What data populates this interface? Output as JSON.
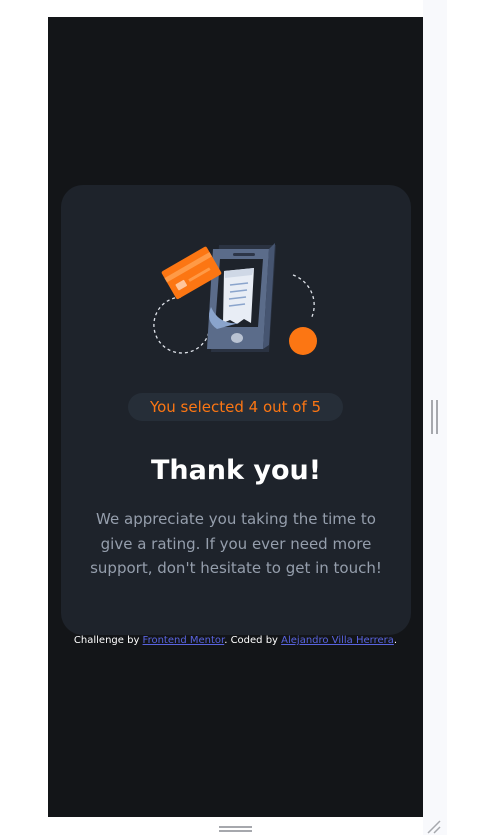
{
  "card": {
    "selection_text": "You selected 4 out of 5",
    "title": "Thank you!",
    "description": "We appreciate you taking the time to give a rating. If you ever need more support, don't hesitate to get in touch!"
  },
  "attribution": {
    "prefix": "Challenge by ",
    "link1": "Frontend Mentor",
    "middle": ". Coded by ",
    "link2": "Alejandro Villa Herrera",
    "suffix": "."
  },
  "rating": {
    "selected": 4,
    "max": 5
  },
  "colors": {
    "background": "#131518",
    "card": "#1e232b",
    "accent": "#fc7613",
    "pill": "#262e38",
    "text_muted": "#959eac",
    "link": "#5964e0"
  },
  "icons": {
    "illustration": "thank-you-phone-receipt-card-illustration"
  }
}
